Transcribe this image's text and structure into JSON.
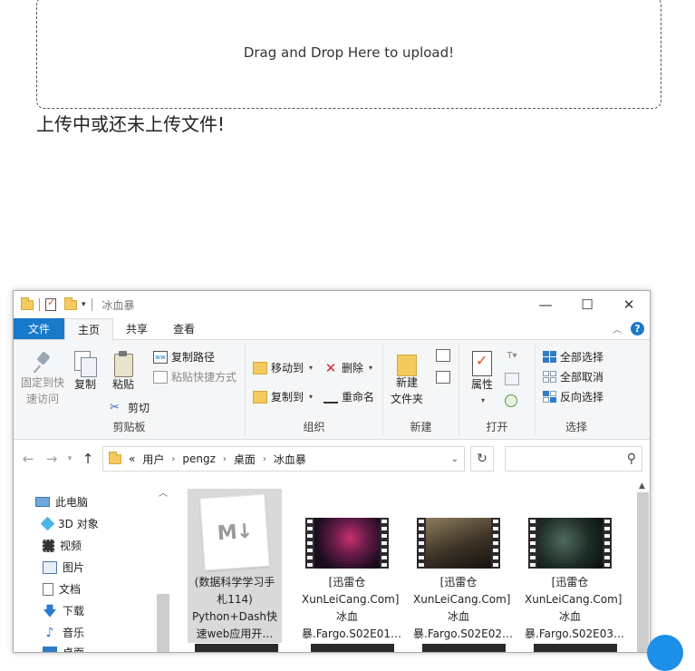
{
  "upload": {
    "dropzone_text": "Drag and Drop Here to upload!",
    "status_text": "上传中或还未上传文件!"
  },
  "window": {
    "title": "冰血暴",
    "controls": {
      "minimize": "—",
      "maximize": "☐",
      "close": "✕"
    }
  },
  "ribbon_tabs": [
    "文件",
    "主页",
    "共享",
    "查看"
  ],
  "ribbon": {
    "clipboard": {
      "label": "剪贴板",
      "pin": "固定到快速访问",
      "copy": "复制",
      "paste": "粘贴",
      "copy_path": "复制路径",
      "paste_shortcut": "粘贴快捷方式",
      "cut": "剪切"
    },
    "organize": {
      "label": "组织",
      "move_to": "移动到",
      "copy_to": "复制到",
      "delete": "删除",
      "rename": "重命名"
    },
    "new": {
      "label": "新建",
      "new_folder": "新建\n文件夹"
    },
    "open": {
      "label": "打开",
      "properties": "属性"
    },
    "select": {
      "label": "选择",
      "select_all": "全部选择",
      "select_none": "全部取消",
      "invert": "反向选择"
    }
  },
  "address": {
    "prefix": "«",
    "crumbs": [
      "用户",
      "pengz",
      "桌面",
      "冰血暴"
    ]
  },
  "nav_pane": [
    "此电脑",
    "3D 对象",
    "视频",
    "图片",
    "文档",
    "下载",
    "音乐",
    "桌面"
  ],
  "files": [
    {
      "name": "(数据科学学习手札114) Python+Dash快速web应用开…",
      "kind": "markdown",
      "selected": true
    },
    {
      "name": "[迅雷仓XunLeiCang.Com]冰血暴.Fargo.S02E01…",
      "kind": "video",
      "selected": false
    },
    {
      "name": "[迅雷仓XunLeiCang.Com]冰血暴.Fargo.S02E02…",
      "kind": "video",
      "selected": false
    },
    {
      "name": "[迅雷仓XunLeiCang.Com]冰血暴.Fargo.S02E03…",
      "kind": "video",
      "selected": false
    }
  ]
}
